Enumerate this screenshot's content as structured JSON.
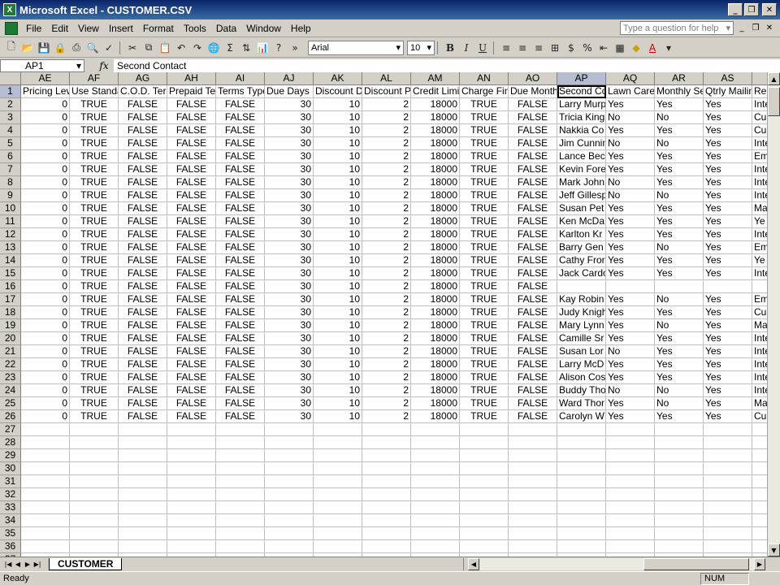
{
  "window": {
    "title": "Microsoft Excel - CUSTOMER.CSV",
    "app_icon_letter": "X"
  },
  "menu": {
    "items": [
      "File",
      "Edit",
      "View",
      "Insert",
      "Format",
      "Tools",
      "Data",
      "Window",
      "Help"
    ],
    "help_placeholder": "Type a question for help"
  },
  "toolbar": {
    "font_name": "Arial",
    "font_size": "10"
  },
  "formula_bar": {
    "name_box": "AP1",
    "fx": "fx",
    "formula": "Second Contact"
  },
  "sheet": {
    "active_cell": {
      "col": "AP",
      "row": 1
    },
    "columns": [
      {
        "letter": "AE",
        "header": "Pricing Level",
        "align": "r"
      },
      {
        "letter": "AF",
        "header": "Use Standard",
        "align": "c"
      },
      {
        "letter": "AG",
        "header": "C.O.D. Terms",
        "align": "c"
      },
      {
        "letter": "AH",
        "header": "Prepaid Terms",
        "align": "c"
      },
      {
        "letter": "AI",
        "header": "Terms Type",
        "align": "c"
      },
      {
        "letter": "AJ",
        "header": "Due Days",
        "align": "r"
      },
      {
        "letter": "AK",
        "header": "Discount Days",
        "align": "r"
      },
      {
        "letter": "AL",
        "header": "Discount Percent",
        "align": "r"
      },
      {
        "letter": "AM",
        "header": "Credit Limit",
        "align": "r"
      },
      {
        "letter": "AN",
        "header": "Charge Finance",
        "align": "c"
      },
      {
        "letter": "AO",
        "header": "Due Month",
        "align": "c"
      },
      {
        "letter": "AP",
        "header": "Second Contact",
        "align": "l"
      },
      {
        "letter": "AQ",
        "header": "Lawn Care",
        "align": "l"
      },
      {
        "letter": "AR",
        "header": "Monthly Service",
        "align": "l"
      },
      {
        "letter": "AS",
        "header": "Qtrly Mailing",
        "align": "l"
      },
      {
        "letter": "AT",
        "header": "Re",
        "align": "l"
      }
    ],
    "rows": [
      [
        "0",
        "TRUE",
        "FALSE",
        "FALSE",
        "FALSE",
        "30",
        "10",
        "2",
        "18000",
        "TRUE",
        "FALSE",
        "Larry Murphy",
        "Yes",
        "Yes",
        "Yes",
        "Inte"
      ],
      [
        "0",
        "TRUE",
        "FALSE",
        "FALSE",
        "FALSE",
        "30",
        "10",
        "2",
        "18000",
        "TRUE",
        "FALSE",
        "Tricia King",
        "No",
        "No",
        "Yes",
        "Cu"
      ],
      [
        "0",
        "TRUE",
        "FALSE",
        "FALSE",
        "FALSE",
        "30",
        "10",
        "2",
        "18000",
        "TRUE",
        "FALSE",
        "Nakkia Co",
        "Yes",
        "Yes",
        "Yes",
        "Cu"
      ],
      [
        "0",
        "TRUE",
        "FALSE",
        "FALSE",
        "FALSE",
        "30",
        "10",
        "2",
        "18000",
        "TRUE",
        "FALSE",
        "Jim Cunnin",
        "No",
        "No",
        "Yes",
        "Inte"
      ],
      [
        "0",
        "TRUE",
        "FALSE",
        "FALSE",
        "FALSE",
        "30",
        "10",
        "2",
        "18000",
        "TRUE",
        "FALSE",
        "Lance Bec",
        "Yes",
        "Yes",
        "Yes",
        "Em"
      ],
      [
        "0",
        "TRUE",
        "FALSE",
        "FALSE",
        "FALSE",
        "30",
        "10",
        "2",
        "18000",
        "TRUE",
        "FALSE",
        "Kevin Fore",
        "Yes",
        "Yes",
        "Yes",
        "Inte"
      ],
      [
        "0",
        "TRUE",
        "FALSE",
        "FALSE",
        "FALSE",
        "30",
        "10",
        "2",
        "18000",
        "TRUE",
        "FALSE",
        "Mark John",
        "No",
        "Yes",
        "Yes",
        "Inte"
      ],
      [
        "0",
        "TRUE",
        "FALSE",
        "FALSE",
        "FALSE",
        "30",
        "10",
        "2",
        "18000",
        "TRUE",
        "FALSE",
        "Jeff Gillesp",
        "No",
        "No",
        "Yes",
        "Inte"
      ],
      [
        "0",
        "TRUE",
        "FALSE",
        "FALSE",
        "FALSE",
        "30",
        "10",
        "2",
        "18000",
        "TRUE",
        "FALSE",
        "Susan Pet",
        "Yes",
        "Yes",
        "Yes",
        "Ma"
      ],
      [
        "0",
        "TRUE",
        "FALSE",
        "FALSE",
        "FALSE",
        "30",
        "10",
        "2",
        "18000",
        "TRUE",
        "FALSE",
        "Ken McDa",
        "Yes",
        "Yes",
        "Yes",
        "Ye"
      ],
      [
        "0",
        "TRUE",
        "FALSE",
        "FALSE",
        "FALSE",
        "30",
        "10",
        "2",
        "18000",
        "TRUE",
        "FALSE",
        "Karlton Kr",
        "Yes",
        "Yes",
        "Yes",
        "Inte"
      ],
      [
        "0",
        "TRUE",
        "FALSE",
        "FALSE",
        "FALSE",
        "30",
        "10",
        "2",
        "18000",
        "TRUE",
        "FALSE",
        "Barry Gen",
        "Yes",
        "No",
        "Yes",
        "Em"
      ],
      [
        "0",
        "TRUE",
        "FALSE",
        "FALSE",
        "FALSE",
        "30",
        "10",
        "2",
        "18000",
        "TRUE",
        "FALSE",
        "Cathy Fror",
        "Yes",
        "Yes",
        "Yes",
        "Ye"
      ],
      [
        "0",
        "TRUE",
        "FALSE",
        "FALSE",
        "FALSE",
        "30",
        "10",
        "2",
        "18000",
        "TRUE",
        "FALSE",
        "Jack Cardo",
        "Yes",
        "Yes",
        "Yes",
        "Inte"
      ],
      [
        "0",
        "TRUE",
        "FALSE",
        "FALSE",
        "FALSE",
        "30",
        "10",
        "2",
        "18000",
        "TRUE",
        "FALSE",
        "",
        "",
        "",
        "",
        ""
      ],
      [
        "0",
        "TRUE",
        "FALSE",
        "FALSE",
        "FALSE",
        "30",
        "10",
        "2",
        "18000",
        "TRUE",
        "FALSE",
        "Kay Robin",
        "Yes",
        "No",
        "Yes",
        "Em"
      ],
      [
        "0",
        "TRUE",
        "FALSE",
        "FALSE",
        "FALSE",
        "30",
        "10",
        "2",
        "18000",
        "TRUE",
        "FALSE",
        "Judy Knigh",
        "Yes",
        "Yes",
        "Yes",
        "Cu"
      ],
      [
        "0",
        "TRUE",
        "FALSE",
        "FALSE",
        "FALSE",
        "30",
        "10",
        "2",
        "18000",
        "TRUE",
        "FALSE",
        "Mary Lynn",
        "Yes",
        "No",
        "Yes",
        "Ma"
      ],
      [
        "0",
        "TRUE",
        "FALSE",
        "FALSE",
        "FALSE",
        "30",
        "10",
        "2",
        "18000",
        "TRUE",
        "FALSE",
        "Camille Sr",
        "Yes",
        "Yes",
        "Yes",
        "Inte"
      ],
      [
        "0",
        "TRUE",
        "FALSE",
        "FALSE",
        "FALSE",
        "30",
        "10",
        "2",
        "18000",
        "TRUE",
        "FALSE",
        "Susan Lor",
        "No",
        "Yes",
        "Yes",
        "Inte"
      ],
      [
        "0",
        "TRUE",
        "FALSE",
        "FALSE",
        "FALSE",
        "30",
        "10",
        "2",
        "18000",
        "TRUE",
        "FALSE",
        "Larry McD",
        "Yes",
        "Yes",
        "Yes",
        "Inte"
      ],
      [
        "0",
        "TRUE",
        "FALSE",
        "FALSE",
        "FALSE",
        "30",
        "10",
        "2",
        "18000",
        "TRUE",
        "FALSE",
        "Alison Cos",
        "Yes",
        "Yes",
        "Yes",
        "Inte"
      ],
      [
        "0",
        "TRUE",
        "FALSE",
        "FALSE",
        "FALSE",
        "30",
        "10",
        "2",
        "18000",
        "TRUE",
        "FALSE",
        "Buddy Tho",
        "No",
        "No",
        "Yes",
        "Inte"
      ],
      [
        "0",
        "TRUE",
        "FALSE",
        "FALSE",
        "FALSE",
        "30",
        "10",
        "2",
        "18000",
        "TRUE",
        "FALSE",
        "Ward Thor",
        "Yes",
        "No",
        "Yes",
        "Ma"
      ],
      [
        "0",
        "TRUE",
        "FALSE",
        "FALSE",
        "FALSE",
        "30",
        "10",
        "2",
        "18000",
        "TRUE",
        "FALSE",
        "Carolyn W",
        "Yes",
        "Yes",
        "Yes",
        "Cu"
      ]
    ],
    "row_numbers": [
      1,
      2,
      3,
      4,
      5,
      6,
      7,
      8,
      9,
      10,
      11,
      12,
      13,
      14,
      15,
      16,
      17,
      18,
      19,
      20,
      21,
      22,
      23,
      24,
      25,
      26,
      27,
      28,
      29,
      30,
      31,
      32,
      33,
      34,
      35,
      36,
      37
    ],
    "tab_name": "CUSTOMER"
  },
  "status": {
    "left": "Ready",
    "num": "NUM"
  }
}
